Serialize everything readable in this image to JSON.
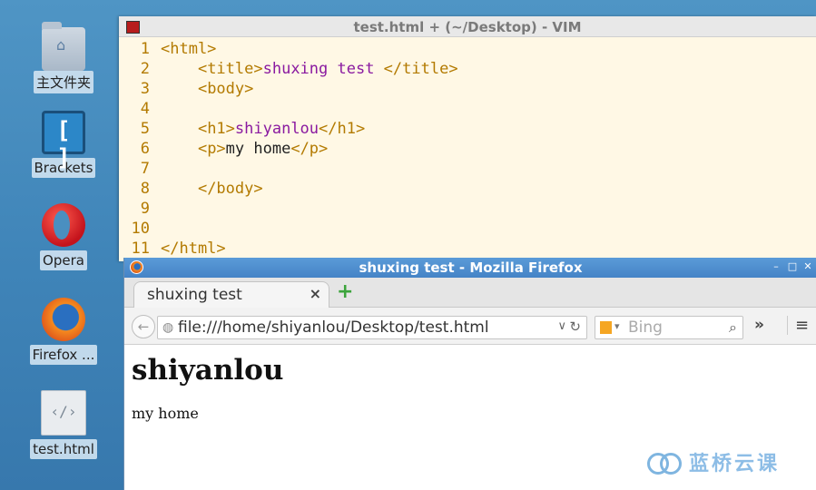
{
  "desktop": {
    "icons": [
      {
        "label": "主文件夹",
        "icon": "home-folder-icon"
      },
      {
        "label": "Brackets",
        "icon": "brackets-icon"
      },
      {
        "label": "Opera",
        "icon": "opera-icon"
      },
      {
        "label": "Firefox ...",
        "icon": "firefox-icon"
      },
      {
        "label": "test.html",
        "icon": "html-file-icon"
      }
    ]
  },
  "vim": {
    "title": "test.html + (~/Desktop) - VIM",
    "lines": [
      {
        "num": "1"
      },
      {
        "num": "2"
      },
      {
        "num": "3"
      },
      {
        "num": "4"
      },
      {
        "num": "5"
      },
      {
        "num": "6"
      },
      {
        "num": "7"
      },
      {
        "num": "8"
      },
      {
        "num": "9"
      },
      {
        "num": "10"
      },
      {
        "num": "11"
      }
    ],
    "code": {
      "l1": "<html>",
      "l2_open": "<title>",
      "l2_text": "shuxing test ",
      "l2_close": "</title>",
      "l3": "<body>",
      "l5_open": "<h1>",
      "l5_text": "shiyanlou",
      "l5_close": "</h1>",
      "l6_open": "<p>",
      "l6_text": "my home",
      "l6_close": "</p>",
      "l8": "</body>",
      "l11": "</html>"
    }
  },
  "firefox": {
    "title": "shuxing test - Mozilla Firefox",
    "tab_label": "shuxing test",
    "tab_close": "×",
    "new_tab": "+",
    "url": "file:///home/shiyanlou/Desktop/test.html",
    "search_placeholder": "Bing",
    "more": "»",
    "menu": "≡",
    "page": {
      "heading": "shiyanlou",
      "paragraph": "my home"
    }
  },
  "watermark": {
    "text": "蓝桥云课"
  }
}
